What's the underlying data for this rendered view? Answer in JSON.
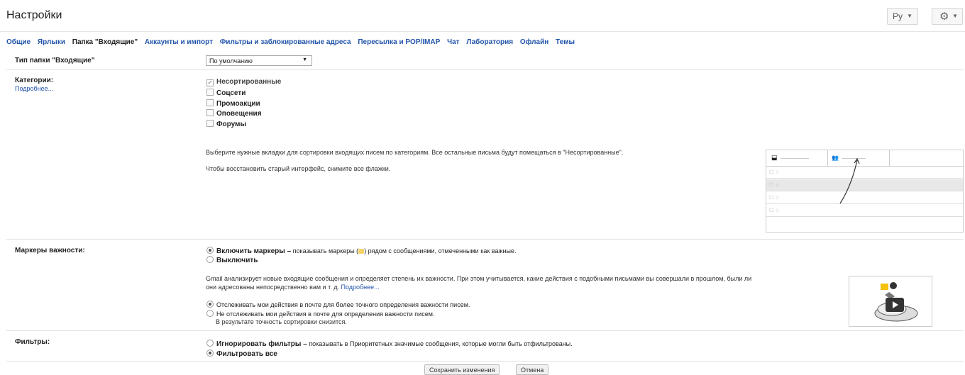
{
  "header": {
    "title": "Настройки",
    "lang": "Ру"
  },
  "tabs": [
    {
      "label": "Общие",
      "active": false
    },
    {
      "label": "Ярлыки",
      "active": false
    },
    {
      "label": "Папка \"Входящие\"",
      "active": true
    },
    {
      "label": "Аккаунты и импорт",
      "active": false
    },
    {
      "label": "Фильтры и заблокированные адреса",
      "active": false
    },
    {
      "label": "Пересылка и POP/IMAP",
      "active": false
    },
    {
      "label": "Чат",
      "active": false
    },
    {
      "label": "Лаборатория",
      "active": false
    },
    {
      "label": "Офлайн",
      "active": false
    },
    {
      "label": "Темы",
      "active": false
    }
  ],
  "inbox_type": {
    "label": "Тип папки \"Входящие\"",
    "value": "По умолчанию"
  },
  "categories": {
    "label": "Категории:",
    "more": "Подробнее...",
    "items": [
      {
        "label": "Несортированные",
        "checked": true
      },
      {
        "label": "Соцсети",
        "checked": false
      },
      {
        "label": "Промоакции",
        "checked": false
      },
      {
        "label": "Оповещения",
        "checked": false
      },
      {
        "label": "Форумы",
        "checked": false
      }
    ],
    "hint": "Выберите нужные вкладки для сортировки входящих писем по категориям. Все остальные письма будут помещаться в \"Несортированные\".",
    "restore": "Чтобы восстановить старый интерфейс, снимите все флажки."
  },
  "importance": {
    "label": "Маркеры важности:",
    "on_bold": "Включить маркеры –",
    "on_rest": "показывать маркеры (",
    "on_rest2": ") рядом с сообщениями, отмеченными как важные.",
    "off": "Выключить",
    "desc1": "Gmail анализирует новые входящие сообщения и определяет степень их важности. При этом учитывается, какие действия с подобными письмами вы совершали в прошлом, были ли",
    "desc2": "они адресованы непосредственно вам и т. д.",
    "desc_link": "Подробнее...",
    "track": "Отслеживать мои действия в почте для более точного определения важности писем.",
    "notrack1": "Не отслеживать мои действия в почте для определения важности писем.",
    "notrack2": "В результате точность сортировки снизится."
  },
  "filters": {
    "label": "Фильтры:",
    "ignore_bold": "Игнорировать фильтры –",
    "ignore_rest": "показывать в Приоритетных значимые сообщения, которые могли быть отфильтрованы.",
    "all": "Фильтровать все"
  },
  "buttons": {
    "save": "Сохранить изменения",
    "cancel": "Отмена"
  }
}
